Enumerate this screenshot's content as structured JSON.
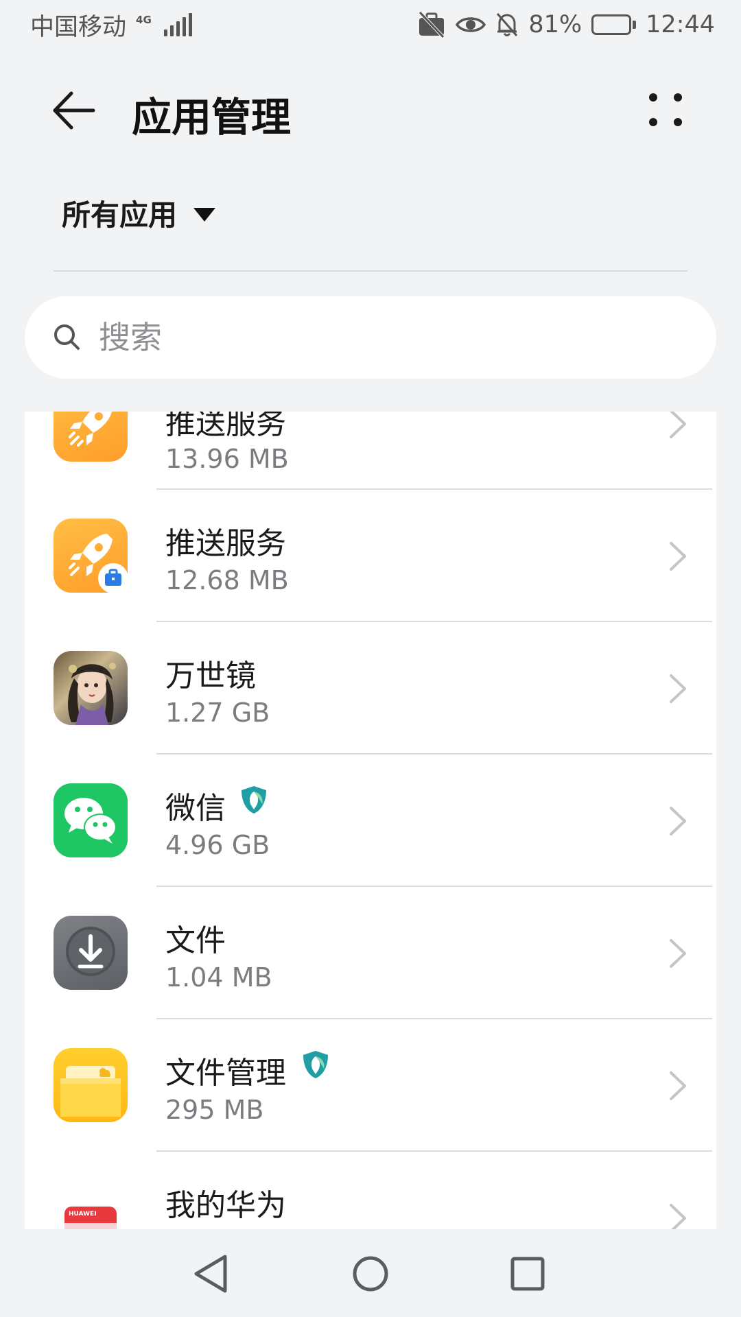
{
  "status_bar": {
    "carrier": "中国移动",
    "network": "4G",
    "battery": "81%",
    "battery_level": 0.81,
    "time": "12:44",
    "icons": [
      "briefcase-off-icon",
      "eye-icon",
      "bell-off-icon",
      "battery-icon"
    ]
  },
  "header": {
    "title": "应用管理",
    "back_icon": "arrow-left-icon",
    "more_icon": "more-dots-icon"
  },
  "filter": {
    "label": "所有应用",
    "icon": "dropdown-triangle-icon"
  },
  "search": {
    "placeholder": "搜索",
    "value": ""
  },
  "apps": [
    {
      "name": "推送服务",
      "size": "13.96 MB",
      "icon": "rocket-icon",
      "badge": ""
    },
    {
      "name": "推送服务",
      "size": "12.68 MB",
      "icon": "rocket-work-icon",
      "badge": "briefcase-badge-icon"
    },
    {
      "name": "万世镜",
      "size": "1.27 GB",
      "icon": "game-portrait-icon",
      "badge": ""
    },
    {
      "name": "微信",
      "size": "4.96 GB",
      "icon": "wechat-icon",
      "badge": "protected-shield-icon"
    },
    {
      "name": "文件",
      "size": "1.04 MB",
      "icon": "download-icon",
      "badge": ""
    },
    {
      "name": "文件管理",
      "size": "295 MB",
      "icon": "folder-icon",
      "badge": "protected-shield-icon"
    },
    {
      "name": "我的华为",
      "size": "",
      "icon": "huawei-icon",
      "badge": ""
    }
  ],
  "huawei_icon_text": "HUAWEI",
  "colors": {
    "background": "#f1f3f5",
    "rocket_orange": "#ffa531",
    "wechat_green": "#1ec763",
    "folder_yellow": "#ffc21a",
    "badge_blue": "#2a7be4"
  },
  "nav": {
    "back_icon": "nav-back-triangle-icon",
    "home_icon": "nav-home-circle-icon",
    "recent_icon": "nav-recent-square-icon"
  }
}
